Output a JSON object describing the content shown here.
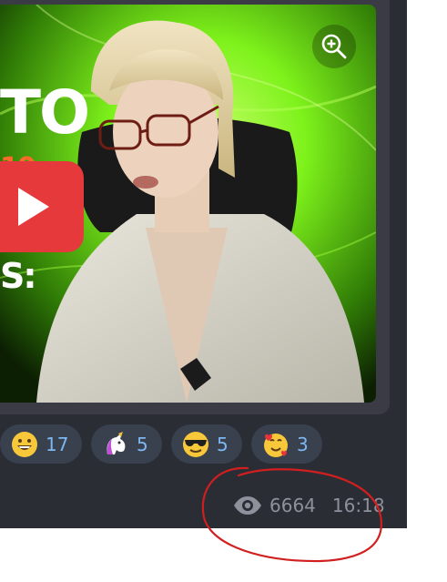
{
  "thumbnail": {
    "headline_top": "TO",
    "headline_mid": "10",
    "headline_bottom": "S:"
  },
  "reactions": [
    {
      "emoji": "grinning-face",
      "count": "17"
    },
    {
      "emoji": "unicorn",
      "count": "5"
    },
    {
      "emoji": "smiling-face-with-sunglasses",
      "count": "5"
    },
    {
      "emoji": "smiling-face-with-hearts",
      "count": "3"
    }
  ],
  "message_meta": {
    "views": "6664",
    "time": "16:18"
  },
  "colors": {
    "chat_background": "#2b2d35",
    "bubble": "#3a3b45",
    "reaction_pill": "#39404e",
    "reaction_count": "#7cb7f2",
    "meta_text": "#8d919c",
    "annotation": "#d11f1f",
    "thumbnail_glow": "#7ef21b",
    "play_badge": "#e6393b"
  },
  "icons": {
    "zoom": "zoom-in-icon",
    "play": "play-icon",
    "views": "eye-icon"
  }
}
